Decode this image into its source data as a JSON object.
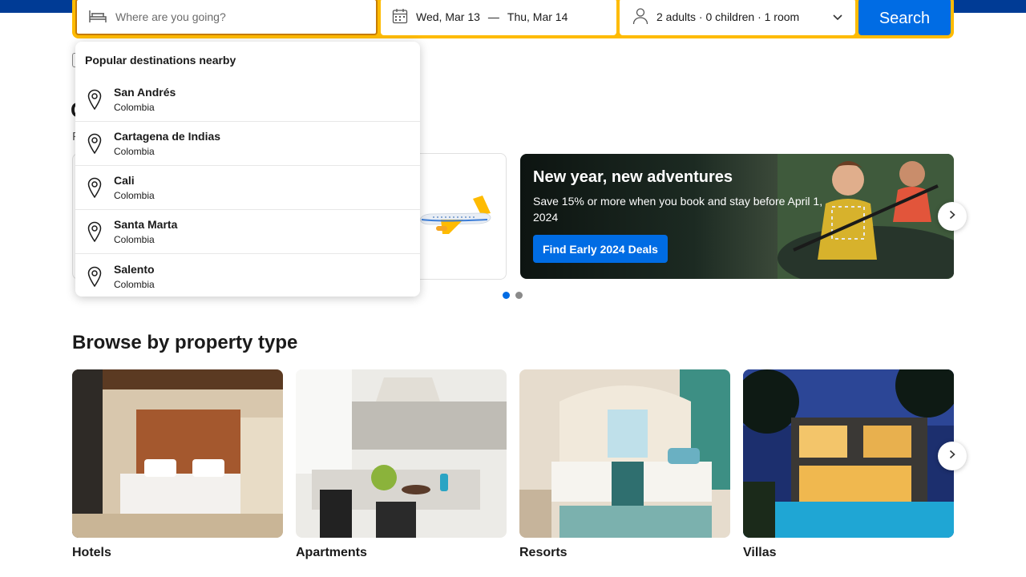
{
  "search": {
    "destination_placeholder": "Where are you going?",
    "destination_value": "",
    "checkin": "Wed, Mar 13",
    "date_separator": "—",
    "checkout": "Thu, Mar 14",
    "guests": "2 adults · 0 children · 1 room",
    "button_label": "Search"
  },
  "dropdown": {
    "title": "Popular destinations nearby",
    "items": [
      {
        "name": "San Andrés",
        "country": "Colombia"
      },
      {
        "name": "Cartagena de Indias",
        "country": "Colombia"
      },
      {
        "name": "Cali",
        "country": "Colombia"
      },
      {
        "name": "Santa Marta",
        "country": "Colombia"
      },
      {
        "name": "Salento",
        "country": "Colombia"
      }
    ]
  },
  "offers": {
    "banner_title": "New year, new adventures",
    "banner_text": "Save 15% or more when you book and stay before April 1, 2024",
    "banner_button": "Find Early 2024 Deals",
    "carousel_pages": 2,
    "active_page": 1
  },
  "property_types": {
    "title": "Browse by property type",
    "items": [
      {
        "label": "Hotels"
      },
      {
        "label": "Apartments"
      },
      {
        "label": "Resorts"
      },
      {
        "label": "Villas"
      }
    ]
  },
  "colors": {
    "brand_blue": "#003b95",
    "action_blue": "#006ce4",
    "search_yellow": "#febb02"
  },
  "icons": [
    "bed-icon",
    "calendar-icon",
    "person-icon",
    "chevron-down-icon",
    "location-pin-icon",
    "chevron-right-icon"
  ]
}
